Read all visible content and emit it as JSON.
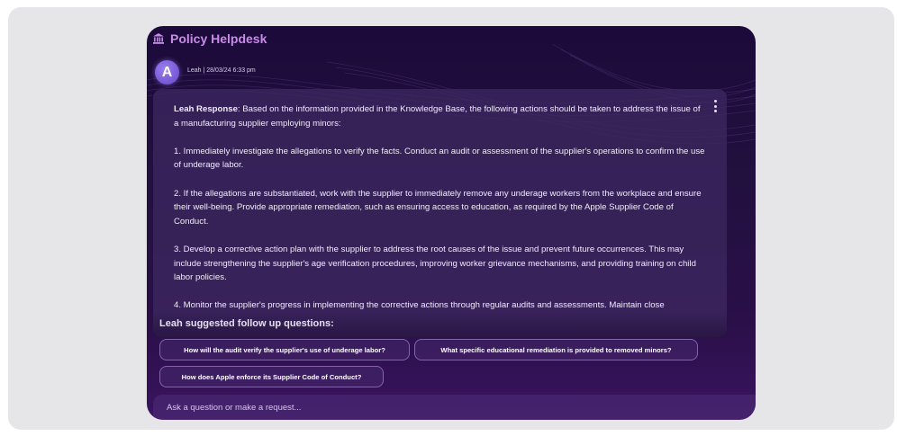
{
  "header": {
    "title": "Policy Helpdesk",
    "icon": "bank-icon"
  },
  "message": {
    "avatar_letter": "A",
    "meta": "Leah | 28/03/24 6:33 pm",
    "response_label": "Leah Response",
    "paragraphs": [
      ": Based on the information provided in the Knowledge Base, the following actions should be taken to address the issue of a manufacturing supplier employing minors:",
      "1. Immediately investigate the allegations to verify the facts. Conduct an audit or assessment of the supplier's operations to confirm the use of underage labor.",
      "2. If the allegations are substantiated, work with the supplier to immediately remove any underage workers from the workplace and ensure their well-being. Provide appropriate remediation, such as ensuring access to education, as required by the Apple Supplier Code of Conduct.",
      "3. Develop a corrective action plan with the supplier to address the root causes of the issue and prevent future occurrences. This may include strengthening the supplier's age verification procedures, improving worker grievance mechanisms, and providing training on child labor policies.",
      "4. Monitor the supplier's progress in implementing the corrective actions through regular audits and assessments. Maintain close"
    ]
  },
  "followups": {
    "title": "Leah suggested follow up questions:",
    "chips": [
      "How will the audit verify the supplier's use of underage labor?",
      "What specific educational remediation is provided to removed minors?",
      "How does Apple enforce its Supplier Code of Conduct?"
    ]
  },
  "input": {
    "placeholder": "Ask a question or make a request..."
  },
  "colors": {
    "title_accent": "#c98be8",
    "window_bg": "#1c0a3a",
    "frame_bg": "#e6e6e8"
  }
}
